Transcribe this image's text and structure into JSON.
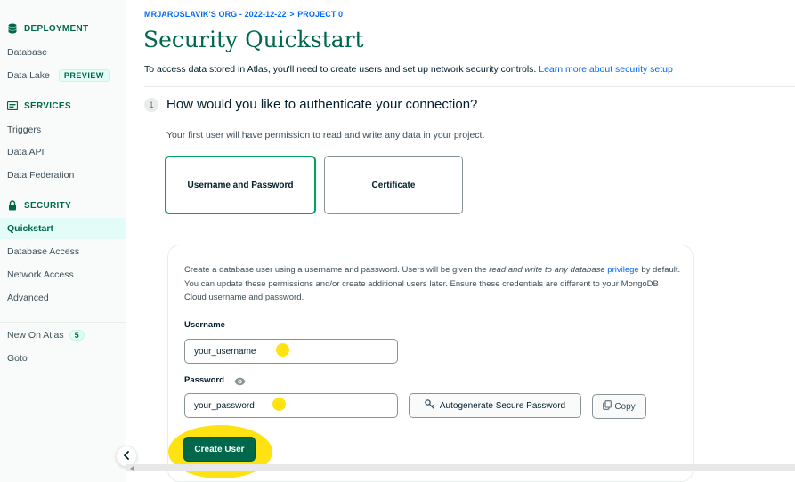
{
  "sidebar": {
    "deployment": {
      "heading": "DEPLOYMENT",
      "icon": "database-icon",
      "items": [
        {
          "label": "Database"
        },
        {
          "label": "Data Lake",
          "badge": "PREVIEW"
        }
      ]
    },
    "services": {
      "heading": "SERVICES",
      "icon": "services-icon",
      "items": [
        {
          "label": "Triggers"
        },
        {
          "label": "Data API"
        },
        {
          "label": "Data Federation"
        }
      ]
    },
    "security": {
      "heading": "SECURITY",
      "icon": "lock-icon",
      "items": [
        {
          "label": "Quickstart",
          "active": true
        },
        {
          "label": "Database Access"
        },
        {
          "label": "Network Access"
        },
        {
          "label": "Advanced"
        }
      ]
    },
    "extras": [
      {
        "label": "New On Atlas",
        "count": "5"
      },
      {
        "label": "Goto"
      }
    ]
  },
  "breadcrumb": {
    "org": "MRJAROSLAVIK'S ORG - 2022-12-22",
    "sep": ">",
    "project": "PROJECT 0"
  },
  "page_title": "Security Quickstart",
  "intro": {
    "text": "To access data stored in Atlas, you'll need to create users and set up network security controls.",
    "link": "Learn more about security setup"
  },
  "step": {
    "number": "1",
    "question": "How would you like to authenticate your connection?",
    "subtext": "Your first user will have permission to read and write any data in your project."
  },
  "auth_options": {
    "selected": "Username and Password",
    "other": "Certificate"
  },
  "form": {
    "desc_part1": "Create a database user using a username and password. Users will be given the",
    "desc_em": "read and write to any database",
    "desc_link": "privilege",
    "desc_part2": "by default. You can update these permissions and/or create additional users later. Ensure these credentials are different to your MongoDB Cloud username and password.",
    "username_label": "Username",
    "username_value": "your_username",
    "password_label": "Password",
    "password_value": "your_password",
    "autogen_label": "Autogenerate Secure Password",
    "copy_label": "Copy",
    "create_label": "Create User"
  },
  "colors": {
    "brand_green": "#00684a",
    "accent_green": "#00a35c",
    "link_blue": "#016bf8",
    "highlight_yellow": "#ffe212"
  }
}
